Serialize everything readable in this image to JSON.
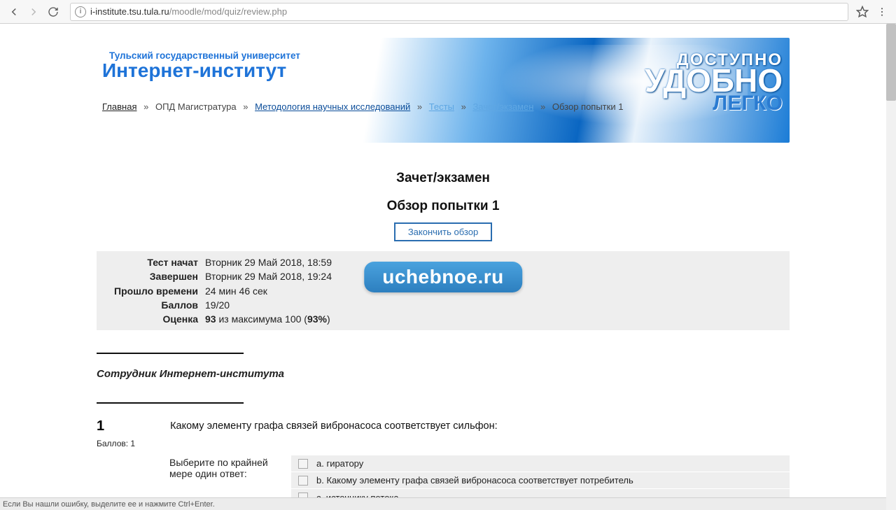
{
  "browser": {
    "url_host": "i-institute.tsu.tula.ru",
    "url_path": "/moodle/mod/quiz/review.php"
  },
  "banner": {
    "subtitle": "Тульский государственный университет",
    "title": "Интернет-институт",
    "slogan1": "ДОСТУПНО",
    "slogan2": "УДОБНО",
    "slogan3": "ЛЕГКО"
  },
  "breadcrumbs": {
    "home": "Главная",
    "sep": "»",
    "item1": "ОПД Магистратура",
    "item2": "Методология научных исследований",
    "item3": "Тесты",
    "item4": "Зачет/экзамен",
    "current": "Обзор попытки 1"
  },
  "headings": {
    "h2": "Зачет/экзамен",
    "h3": "Обзор попытки 1"
  },
  "finish_button": "Закончить обзор",
  "watermark": "uchebnoe.ru",
  "summary": {
    "started_label": "Тест начат",
    "started_value": "Вторник 29 Май 2018, 18:59",
    "completed_label": "Завершен",
    "completed_value": "Вторник 29 Май 2018, 19:24",
    "elapsed_label": "Прошло времени",
    "elapsed_value": "24 мин 46 сек",
    "points_label": "Баллов",
    "points_value": "19/20",
    "grade_label": "Оценка",
    "grade_value_html": "93 из максимума 100 (93%)",
    "grade_strong1": "93",
    "grade_mid": " из максимума 100 (",
    "grade_strong2": "93%",
    "grade_tail": ")"
  },
  "staff_label": "Сотрудник Интернет-института",
  "question": {
    "number": "1",
    "text": "Какому элементу графа связей вибронасоса соответствует сильфон:",
    "score": "Баллов: 1",
    "hint": "Выберите по крайней мере один ответ:",
    "answers": {
      "a": "a. гиратору",
      "b": "b. Какому элементу графа связей вибронасоса соответствует потребитель",
      "c": "c. источнику потока"
    }
  },
  "footer_hint": "Если Вы нашли ошибку, выделите ее и нажмите Ctrl+Enter."
}
